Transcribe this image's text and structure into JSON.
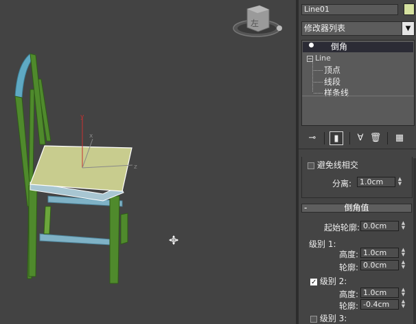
{
  "viewport": {
    "viewcube_face": "左",
    "gizmo_axes": {
      "y": "y",
      "x": "x",
      "z": "z"
    },
    "cursor_icon": "move-cursor-icon"
  },
  "panel": {
    "object_name": "Line01",
    "object_color": "#d6e2a0",
    "modifier_list": "修改器列表",
    "stack": {
      "selected": "倒角",
      "base": "Line",
      "subobjects": [
        "顶点",
        "线段",
        "样条线"
      ]
    },
    "toolbar_icons": [
      "pin-stack-icon",
      "show-end-result-icon",
      "make-unique-icon",
      "remove-modifier-icon",
      "configure-modifier-sets-icon"
    ],
    "avoid_intersect": {
      "label": "避免线相交",
      "checked": false
    },
    "separation": {
      "label": "分离:",
      "value": "1.0cm"
    },
    "bevel_values": {
      "title": "倒角值",
      "start_outline": {
        "label": "起始轮廓:",
        "value": "0.0cm"
      },
      "level1": {
        "label": "级别 1:",
        "height": {
          "label": "高度:",
          "value": "1.0cm"
        },
        "outline": {
          "label": "轮廓:",
          "value": "0.0cm"
        }
      },
      "level2": {
        "label": "级别 2:",
        "checked": true,
        "height": {
          "label": "高度:",
          "value": "1.0cm"
        },
        "outline": {
          "label": "轮廓:",
          "value": "-0.4cm"
        }
      },
      "level3": {
        "label": "级别 3:",
        "checked": false
      }
    }
  }
}
